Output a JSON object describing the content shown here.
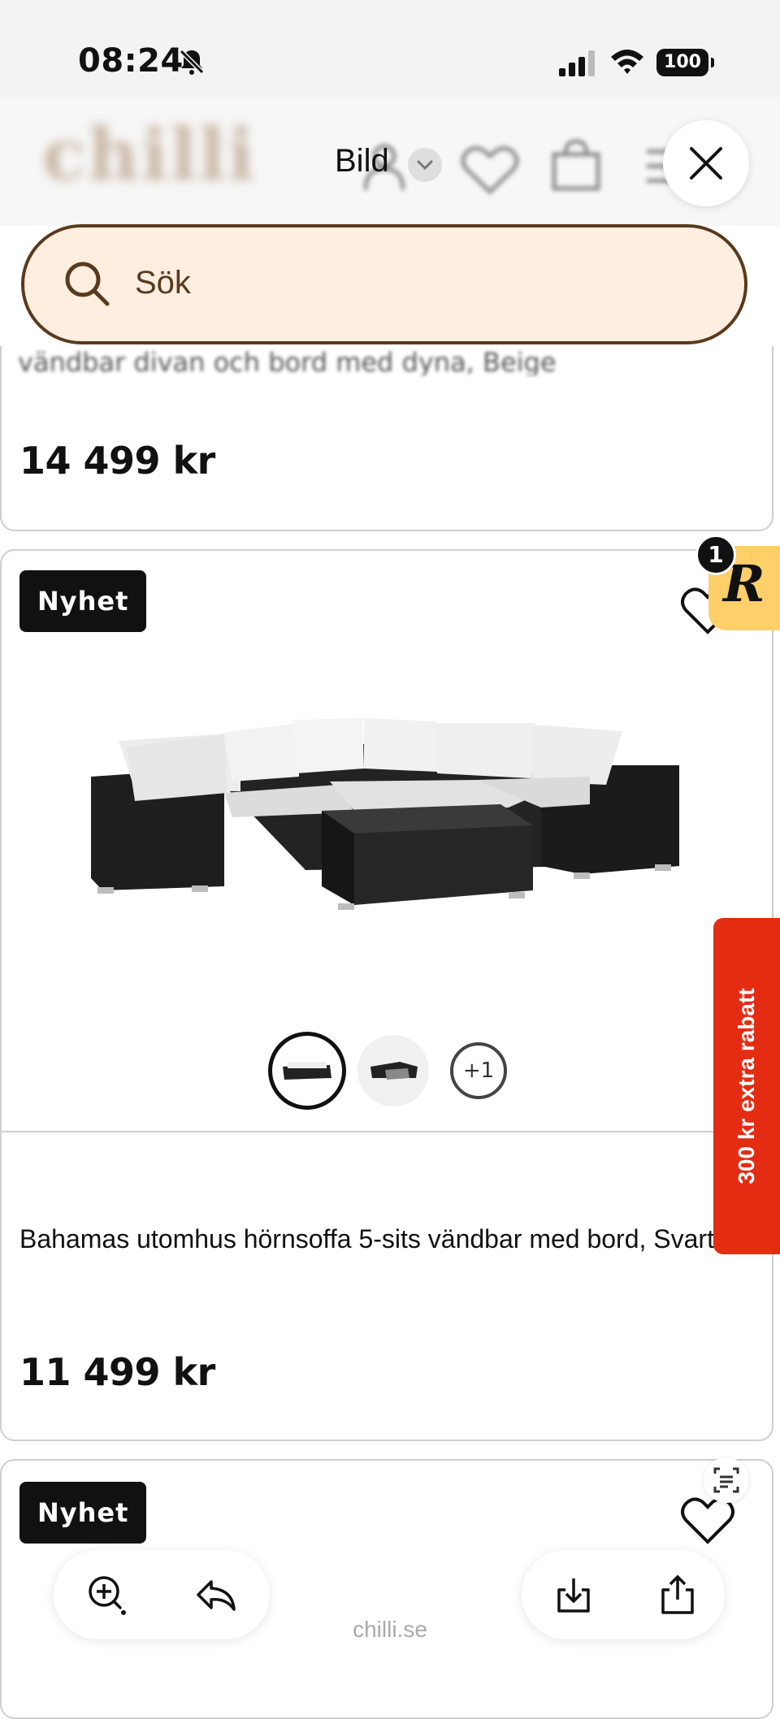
{
  "status_bar": {
    "time": "08:24",
    "battery": "100"
  },
  "header": {
    "logo": "chilli",
    "mode_label": "Bild"
  },
  "search": {
    "placeholder": "Sök"
  },
  "products": [
    {
      "title_cut": "vändbar divan och bord med dyna, Beige",
      "price": "14 499 kr"
    },
    {
      "badge": "Nyhet",
      "title": "Bahamas utomhus hörnsoffa 5-sits vändbar med bord, Svart",
      "price": "11 499 kr",
      "thumbnails_more": "+1"
    },
    {
      "badge": "Nyhet"
    }
  ],
  "promo_tab": {
    "label": "300 kr extra rabatt"
  },
  "reward_widget": {
    "count": "1",
    "letter": "R"
  },
  "footer": {
    "domain": "chilli.se"
  },
  "colors": {
    "search_bg": "#fdeee0",
    "search_border": "#5a3a1c",
    "promo": "#e42c12",
    "reward": "#ffcf6a"
  }
}
